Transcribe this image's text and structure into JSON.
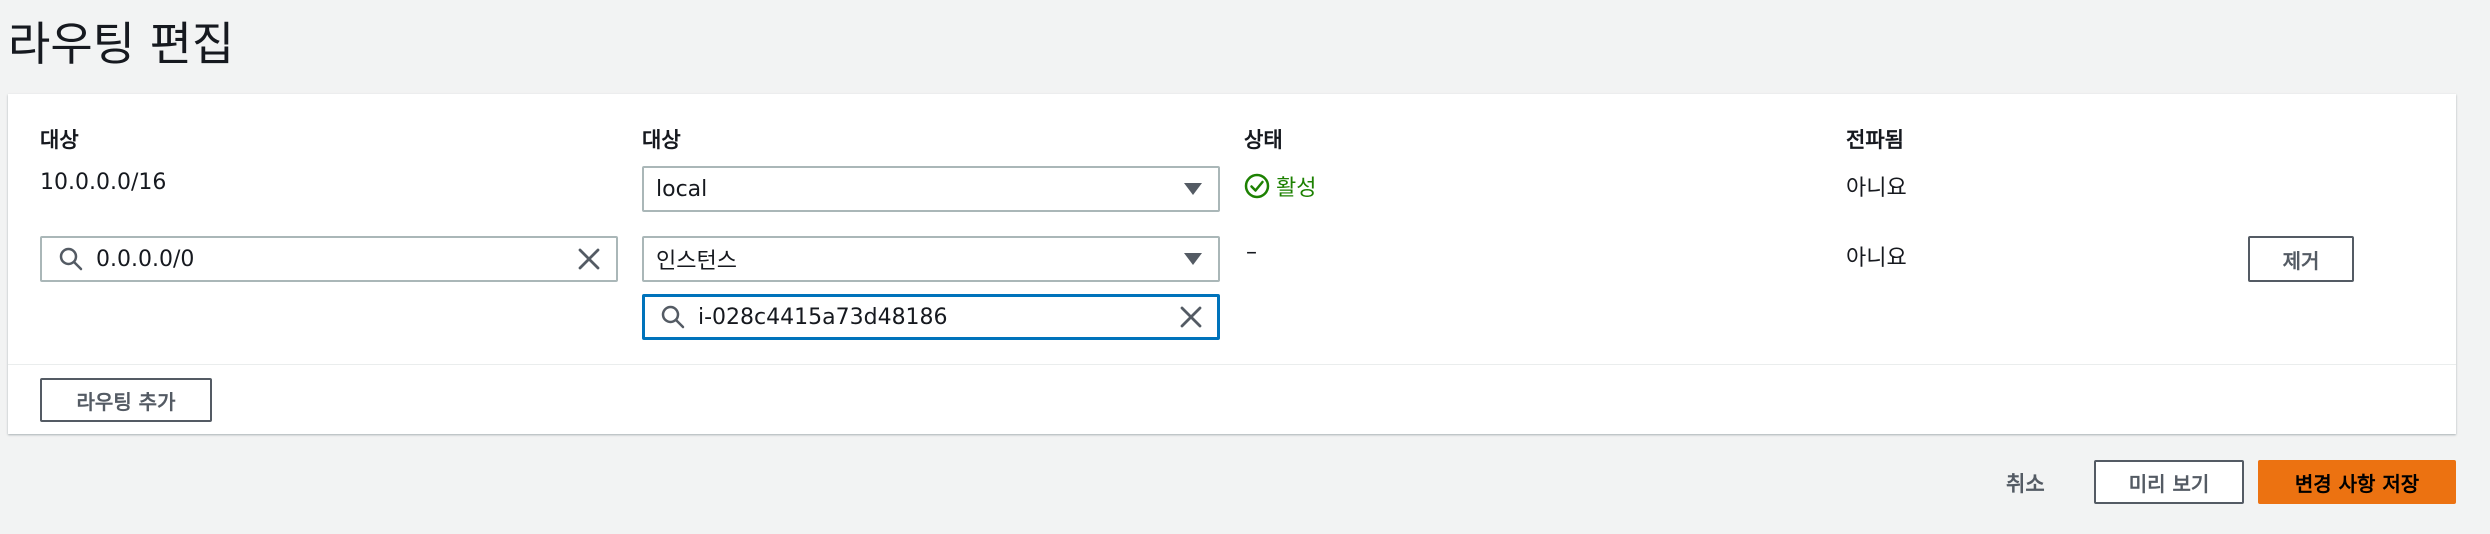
{
  "page": {
    "title": "라우팅 편집"
  },
  "table": {
    "headers": {
      "destination": "대상",
      "target": "대상",
      "status": "상태",
      "propagated": "전파됨"
    },
    "rows": [
      {
        "destination": "10.0.0.0/16",
        "target_select": "local",
        "status": "활성",
        "propagated": "아니요"
      },
      {
        "destination_input": "0.0.0.0/0",
        "target_select": "인스턴스",
        "target_search": "i-028c4415a73d48186",
        "status": "–",
        "propagated": "아니요",
        "remove_label": "제거"
      }
    ],
    "add_route_label": "라우팅 추가"
  },
  "footer": {
    "cancel_label": "취소",
    "preview_label": "미리 보기",
    "save_label": "변경 사항 저장"
  },
  "colors": {
    "primary": "#ec7211",
    "focus": "#0073bb",
    "success": "#1d8102"
  },
  "icons": [
    "search-icon",
    "clear-icon",
    "caret-down-icon",
    "status-ok-icon"
  ]
}
